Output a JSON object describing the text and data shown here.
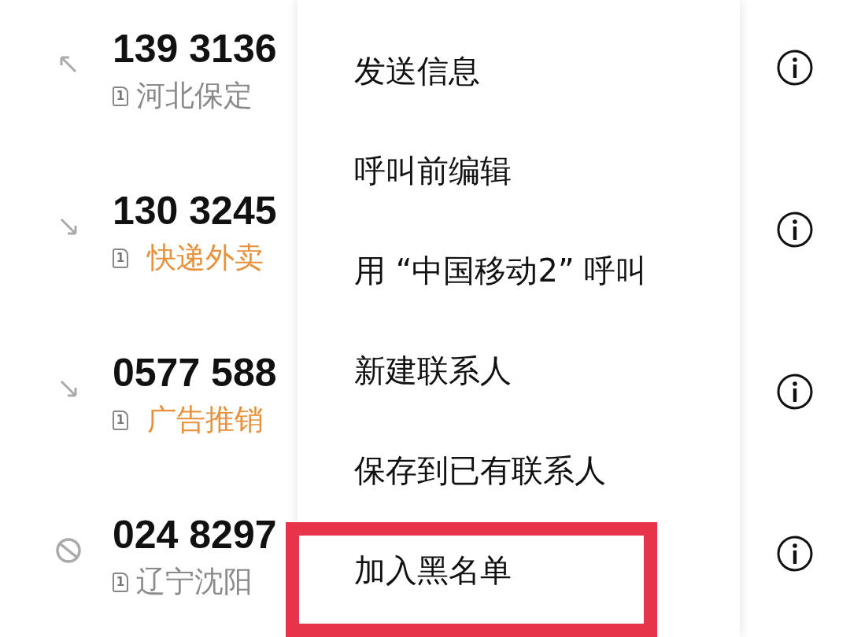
{
  "calls": [
    {
      "number": "139 3136",
      "kind": "outgoing",
      "sim": "1",
      "subtitle": {
        "kind": "location",
        "text": "河北保定"
      }
    },
    {
      "number": "130 3245",
      "kind": "incoming",
      "sim": "1",
      "subtitle": {
        "kind": "tag",
        "text": "快递外卖"
      }
    },
    {
      "number": "0577 588",
      "kind": "incoming",
      "sim": "1",
      "subtitle": {
        "kind": "tag",
        "text": "广告推销"
      }
    },
    {
      "number": "024 8297",
      "kind": "blocked",
      "sim": "1",
      "subtitle": {
        "kind": "location",
        "text": "辽宁沈阳"
      }
    }
  ],
  "menu": {
    "items": [
      {
        "label": "发送信息",
        "highlighted": false
      },
      {
        "label": "呼叫前编辑",
        "highlighted": false
      },
      {
        "label": "用 “中国移动2” 呼叫",
        "highlighted": false
      },
      {
        "label": "新建联系人",
        "highlighted": false
      },
      {
        "label": "保存到已有联系人",
        "highlighted": false
      },
      {
        "label": "加入黑名单",
        "highlighted": true
      }
    ]
  }
}
